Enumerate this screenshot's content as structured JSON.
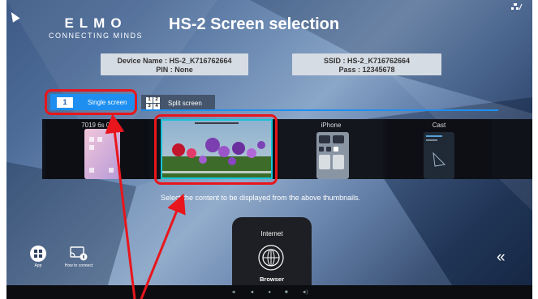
{
  "header": {
    "logo_main": "ELMO",
    "logo_tagline": "CONNECTING MINDS",
    "title": "HS-2 Screen selection"
  },
  "info": {
    "device_line1": "Device Name : HS-2_K716762664",
    "device_line2": "PIN : None",
    "ssid_line1": "SSID : HS-2_K716762664",
    "ssid_line2": "Pass : 12345678"
  },
  "tabs": {
    "single_number": "1",
    "single_label": "Single screen",
    "split_label": "Split screen",
    "split_grid": [
      "1",
      "2",
      "3",
      "4"
    ]
  },
  "thumbnails": [
    {
      "label": "7019 6s 06"
    },
    {
      "label": ""
    },
    {
      "label": "iPhone"
    },
    {
      "label": "Cast"
    }
  ],
  "instruction": "Select the content to be displayed from the above thumbnails.",
  "launcher": {
    "label": "Internet",
    "app_name": "Browser"
  },
  "bottom_left": {
    "app_label": "App",
    "connect_label": "How to connect"
  },
  "collapse_symbol": "«",
  "icons": {
    "app": "grid-icon",
    "connect": "cast-connect-icon",
    "browser": "globe-icon",
    "collapse": "double-chevron-left-icon",
    "corner": "network-settings-icon"
  },
  "colors": {
    "accent_blue": "#1e8ff0",
    "highlight_cyan": "#18c4d8",
    "annotation_red": "#e8161c"
  }
}
